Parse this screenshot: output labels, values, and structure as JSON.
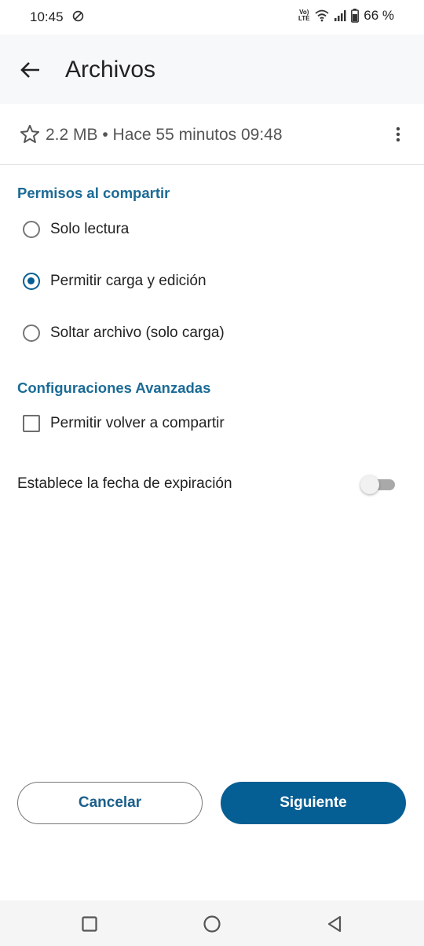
{
  "status_bar": {
    "time": "10:45",
    "network_label": "LTE",
    "battery": "66 %"
  },
  "app_bar": {
    "title": "Archivos"
  },
  "file_info": {
    "meta": "2.2 MB • Hace 55 minutos 09:48"
  },
  "share_permissions": {
    "heading": "Permisos al compartir",
    "options": [
      {
        "label": "Solo lectura",
        "selected": false
      },
      {
        "label": "Permitir carga y edición",
        "selected": true
      },
      {
        "label": "Soltar archivo (solo carga)",
        "selected": false
      }
    ]
  },
  "advanced": {
    "heading": "Configuraciones Avanzadas",
    "allow_reshare": {
      "label": "Permitir volver a compartir",
      "checked": false
    },
    "expiration": {
      "label": "Establece la fecha de expiración",
      "enabled": false
    }
  },
  "actions": {
    "cancel": "Cancelar",
    "next": "Siguiente"
  },
  "colors": {
    "accent": "#065f94",
    "heading": "#1b6b95"
  }
}
